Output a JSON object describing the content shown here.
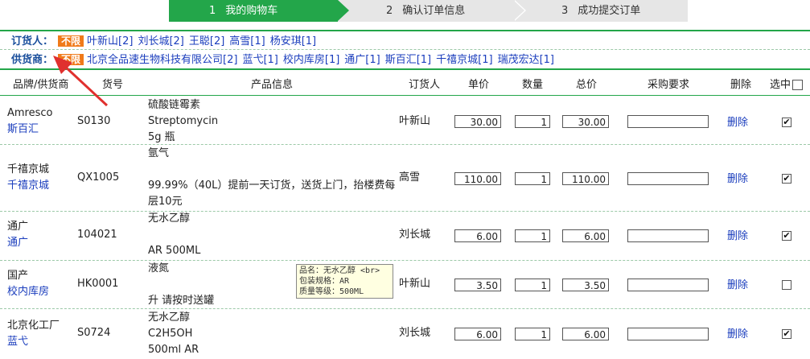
{
  "steps": [
    {
      "num": "1",
      "label": "我的购物车"
    },
    {
      "num": "2",
      "label": "确认订单信息"
    },
    {
      "num": "3",
      "label": "成功提交订单"
    }
  ],
  "filters": {
    "orderer": {
      "label": "订货人：",
      "all": "不限",
      "items": [
        "叶新山[2]",
        "刘长城[2]",
        "王聪[2]",
        "高雪[1]",
        "杨安琪[1]"
      ]
    },
    "supplier": {
      "label": "供货商：",
      "all": "不限",
      "items": [
        "北京全品速生物科技有限公司[2]",
        "蓝弋[1]",
        "校内库房[1]",
        "通广[1]",
        "斯百汇[1]",
        "千禧京城[1]",
        "瑞茂宏达[1]"
      ]
    }
  },
  "table": {
    "headers": {
      "brand": "品牌/供货商",
      "code": "货号",
      "product": "产品信息",
      "orderer": "订货人",
      "price": "单价",
      "qty": "数量",
      "total": "总价",
      "req": "采购要求",
      "delete": "删除",
      "select": "选中"
    },
    "rows": [
      {
        "brand": "Amresco",
        "supplier": "斯百汇",
        "code": "S0130",
        "product": [
          "硫酸链霉素",
          "Streptomycin",
          "5g 瓶"
        ],
        "orderer": "叶新山",
        "price": "30.00",
        "qty": "1",
        "total": "30.00",
        "req": "",
        "delete": "删除",
        "checked": true
      },
      {
        "brand": "千禧京城",
        "supplier": "千禧京城",
        "code": "QX1005",
        "product": [
          "氩气",
          "",
          "99.99%（40L）提前一天订货，送货上门，抬楼费每",
          "层10元"
        ],
        "orderer": "高雪",
        "price": "110.00",
        "qty": "1",
        "total": "110.00",
        "req": "",
        "delete": "删除",
        "checked": true
      },
      {
        "brand": "通广",
        "supplier": "通广",
        "code": "104021",
        "product": [
          "无水乙醇",
          "",
          "AR 500ML"
        ],
        "orderer": "刘长城",
        "price": "6.00",
        "qty": "1",
        "total": "6.00",
        "req": "",
        "delete": "删除",
        "checked": true
      },
      {
        "brand": "国产",
        "supplier": "校内库房",
        "code": "HK0001",
        "product": [
          "液氮",
          "",
          "升 请按时送罐"
        ],
        "orderer": "叶新山",
        "price": "3.50",
        "qty": "1",
        "total": "3.50",
        "req": "",
        "delete": "删除",
        "checked": false
      },
      {
        "brand": "北京化工厂",
        "supplier": "蓝弋",
        "code": "S0724",
        "product": [
          "无水乙醇",
          "C2H5OH",
          "500ml AR"
        ],
        "orderer": "刘长城",
        "price": "6.00",
        "qty": "1",
        "total": "6.00",
        "req": "",
        "delete": "删除",
        "checked": true
      }
    ]
  },
  "tooltip": {
    "lines": [
      "品名：无水乙醇 <br>",
      "包装规格：AR",
      "质量等级：500ML"
    ]
  },
  "colors": {
    "accent": "#23a64a",
    "link": "#1a3dbd",
    "tag": "#f07a1a",
    "arrow": "#e0302e"
  }
}
